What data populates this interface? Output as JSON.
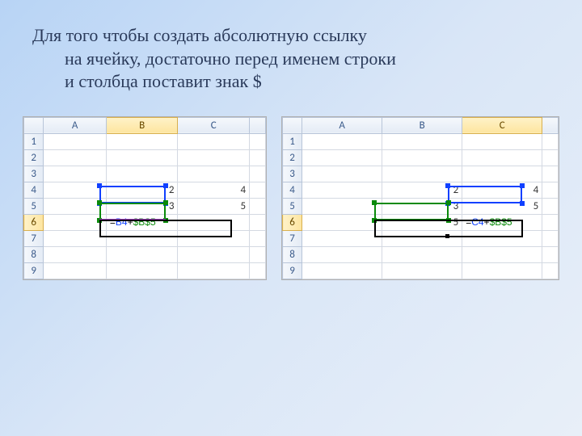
{
  "text": {
    "line1": "Для того чтобы создать абсолютную ссылку",
    "line2": "на ячейку, достаточно перед именем строки",
    "line3": "и столбца поставит знак $"
  },
  "columns": [
    "A",
    "B",
    "C"
  ],
  "rows": [
    "1",
    "2",
    "3",
    "4",
    "5",
    "6",
    "7",
    "8",
    "9"
  ],
  "sheet1": {
    "b4": "2",
    "c4": "4",
    "b5": "3",
    "c5": "5",
    "formula_eq": "=",
    "formula_ref1": "B4",
    "formula_plus": "+",
    "formula_ref2": "$B$5"
  },
  "sheet2": {
    "b4": "2",
    "c4": "4",
    "b5": "3",
    "c5": "5",
    "b6": "5",
    "formula_eq": "=",
    "formula_ref1": "C4",
    "formula_plus": "+",
    "formula_ref2": "$B$5"
  }
}
